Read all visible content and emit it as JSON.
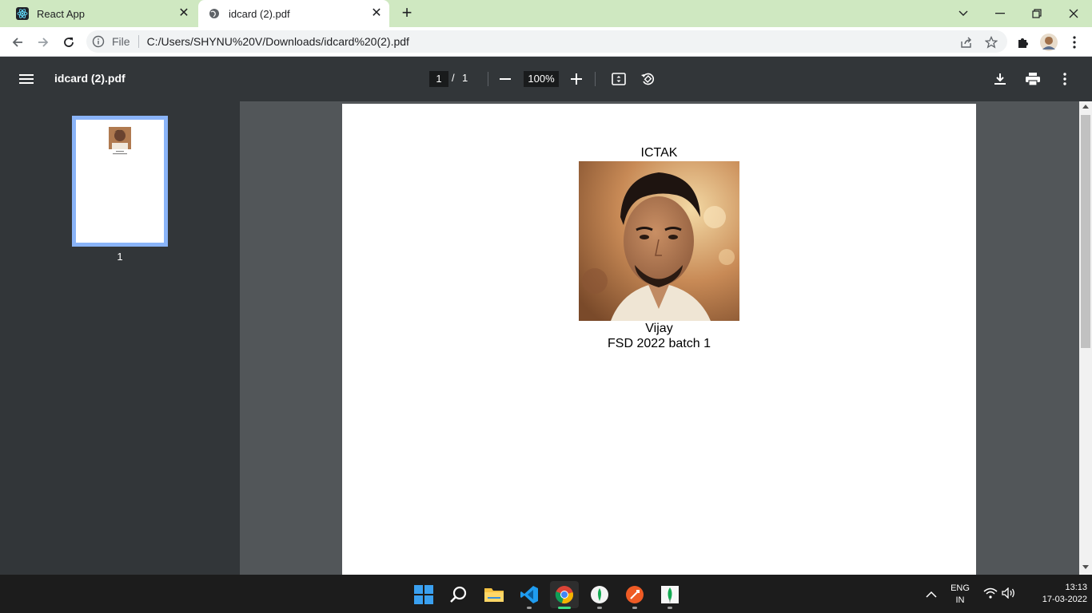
{
  "browser": {
    "tabs": [
      {
        "title": "React App",
        "favicon": "react-icon"
      },
      {
        "title": "idcard (2).pdf",
        "favicon": "globe-icon"
      }
    ],
    "address": {
      "scheme_label": "File",
      "url": "C:/Users/SHYNU%20V/Downloads/idcard%20(2).pdf"
    }
  },
  "pdf_viewer": {
    "title": "idcard (2).pdf",
    "current_page": "1",
    "page_separator": "/",
    "total_pages": "1",
    "zoom": "100%",
    "thumbnail_label": "1"
  },
  "document": {
    "org": "ICTAK",
    "name": "Vijay",
    "batch": "FSD 2022 batch 1"
  },
  "taskbar": {
    "apps": [
      "start-icon",
      "search-icon",
      "file-explorer-icon",
      "vscode-icon",
      "chrome-icon",
      "mongodb-compass-icon",
      "postman-icon",
      "mongodb-icon"
    ],
    "lang_top": "ENG",
    "lang_bottom": "IN",
    "time": "13:13",
    "date": "17-03-2022"
  },
  "colors": {
    "tabstrip": "#cfe8c1",
    "pdf_toolbar": "#323639",
    "viewer_bg": "#525659",
    "thumb_border": "#8ab4f8"
  }
}
